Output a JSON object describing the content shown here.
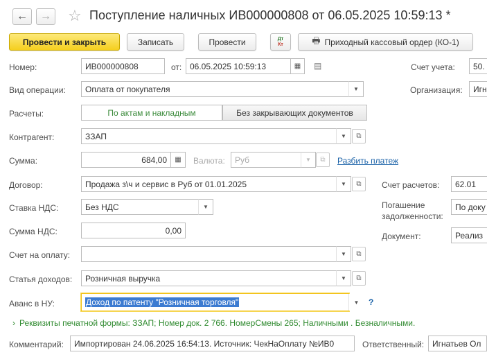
{
  "header": {
    "title": "Поступление наличных ИВ000000808 от 06.05.2025 10:59:13 *",
    "back_icon": "arrow-left-icon",
    "forward_icon": "arrow-right-icon",
    "star_icon": "star-icon"
  },
  "toolbar": {
    "post_close": "Провести и закрыть",
    "save": "Записать",
    "post": "Провести",
    "dtkt_top": "Дт",
    "dtkt_bottom": "Кт",
    "print_order": "Приходный кассовый ордер (КО-1)"
  },
  "form": {
    "number_label": "Номер:",
    "number_value": "ИВ000000808",
    "date_label": "от:",
    "date_value": "06.05.2025 10:59:13",
    "account_label": "Счет учета:",
    "account_value": "50.",
    "operation_label": "Вид операции:",
    "operation_value": "Оплата от покупателя",
    "org_label": "Организация:",
    "org_value": "Игн",
    "settlements_label": "Расчеты:",
    "settlements_opt1": "По актам и накладным",
    "settlements_opt2": "Без закрывающих документов",
    "counterparty_label": "Контрагент:",
    "counterparty_value": "ЗЗАП",
    "amount_label": "Сумма:",
    "amount_value": "684,00",
    "currency_label": "Валюта:",
    "currency_value": "Руб",
    "split_link": "Разбить платеж",
    "contract_label": "Договор:",
    "contract_value": "Продажа з\\ч и сервис в Руб от 01.01.2025",
    "settle_account_label": "Счет расчетов:",
    "settle_account_value": "62.01",
    "vat_rate_label": "Ставка НДС:",
    "vat_rate_value": "Без НДС",
    "repay_label_1": "Погашение",
    "repay_label_2": "задолженности:",
    "repay_value": "По доку",
    "vat_sum_label": "Сумма НДС:",
    "vat_sum_value": "0,00",
    "document_label": "Документ:",
    "document_value": "Реализ",
    "invoice_label": "Счет на оплату:",
    "invoice_value": "",
    "income_item_label": "Статья доходов:",
    "income_item_value": "Розничная выручка",
    "advance_label": "Аванс в НУ:",
    "advance_value": "Доход по патенту \"Розничная торговля\"",
    "help": "?",
    "requisites": "Реквизиты печатной формы: ЗЗАП; Номер док. 2 766. НомерСмены 265; Наличными . Безналичными.",
    "comment_label": "Комментарий:",
    "comment_value": "Импортирован 24.06.2025 16:54:13. Источник: ЧекНаОплату №ИВ0",
    "responsible_label": "Ответственный:",
    "responsible_value": "Игнатьев Ол"
  },
  "colors": {
    "primary_button": "#f5cf1e",
    "link": "#1a62a8",
    "green_text": "#2f8a2f",
    "focus_border": "#f2c218",
    "selection": "#3c7bd1"
  }
}
